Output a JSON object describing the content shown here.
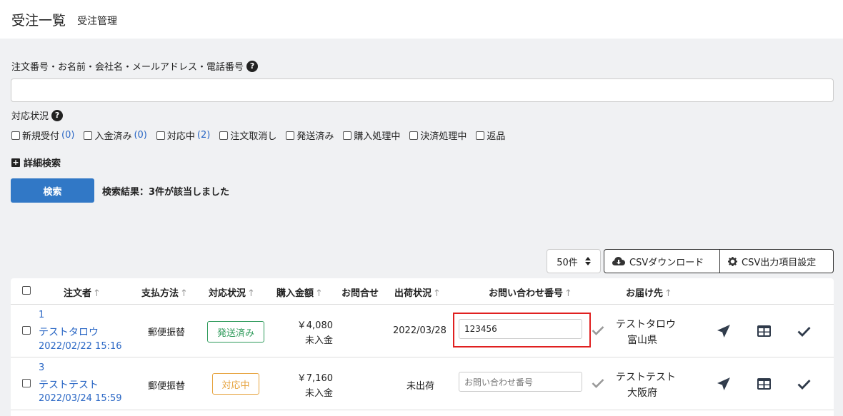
{
  "header": {
    "title": "受注一覧",
    "subtitle": "受注管理"
  },
  "search": {
    "label": "注文番号・お名前・会社名・メールアドレス・電話番号",
    "value": "",
    "placeholder": ""
  },
  "status_filter": {
    "label": "対応状況",
    "options": [
      {
        "label": "新規受付",
        "count": "(0)"
      },
      {
        "label": "入金済み",
        "count": "(0)"
      },
      {
        "label": "対応中",
        "count": "(2)"
      },
      {
        "label": "注文取消し",
        "count": ""
      },
      {
        "label": "発送済み",
        "count": ""
      },
      {
        "label": "購入処理中",
        "count": ""
      },
      {
        "label": "決済処理中",
        "count": ""
      },
      {
        "label": "返品",
        "count": ""
      }
    ]
  },
  "advanced_search": {
    "label": "詳細検索"
  },
  "search_button": {
    "label": "検索"
  },
  "result_text": "検索結果：3件が該当しました",
  "toolbar": {
    "per_page": "50件",
    "csv_download": "CSVダウンロード",
    "csv_settings": "CSV出力項目設定"
  },
  "table": {
    "headers": {
      "orderer": "注文者",
      "payment": "支払方法",
      "status": "対応状況",
      "amount": "購入金額",
      "inquiry": "お問合せ",
      "shipping": "出荷状況",
      "tracking": "お問い合わせ番号",
      "destination": "お届け先"
    },
    "sort_arrow": "↑",
    "rows": [
      {
        "id": "1",
        "name": "テストタロウ",
        "date": "2022/02/22 15:16",
        "payment": "郵便振替",
        "status": "発送済み",
        "status_color": "#2e9a5a",
        "amount": "￥4,080",
        "payment_status": "未入金",
        "shipping": "2022/03/28",
        "tracking_value": "123456",
        "tracking_placeholder": "",
        "dest_name": "テストタロウ",
        "dest_pref": "富山県"
      },
      {
        "id": "3",
        "name": "テストテスト",
        "date": "2022/03/24 15:59",
        "payment": "郵便振替",
        "status": "対応中",
        "status_color": "#e6a23c",
        "amount": "￥7,160",
        "payment_status": "未入金",
        "shipping": "未出荷",
        "tracking_value": "",
        "tracking_placeholder": "お問い合わせ番号",
        "dest_name": "テストテスト",
        "dest_pref": "大阪府"
      }
    ]
  }
}
